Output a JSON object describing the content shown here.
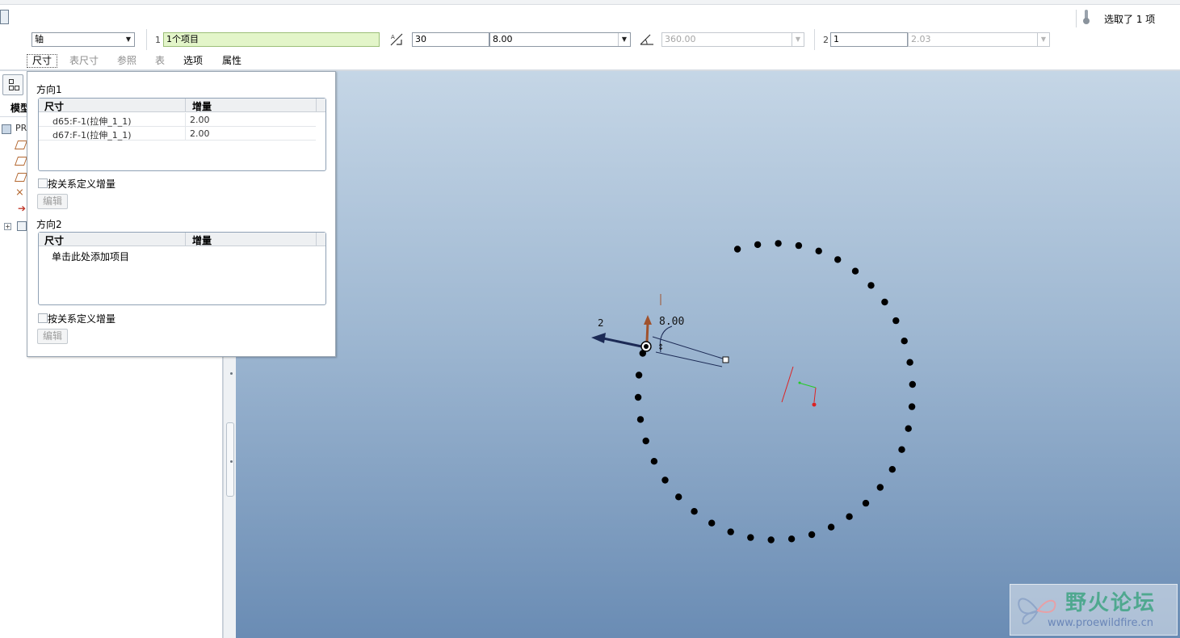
{
  "dashboard": {
    "status_text": "选取了 1 项",
    "type_select": "轴",
    "dir1_index": "1",
    "dir1_collector": "1个项目",
    "count_value": "30",
    "increment_value": "8.00",
    "angle_value": "360.00",
    "dir2_index": "2",
    "dir2_count": "1",
    "dir2_increment": "2.03",
    "tabs": [
      {
        "label": "尺寸"
      },
      {
        "label": "表尺寸"
      },
      {
        "label": "参照"
      },
      {
        "label": "表"
      },
      {
        "label": "选项"
      },
      {
        "label": "属性"
      }
    ]
  },
  "model_tree": {
    "tab_label": "模型",
    "root_label": "PR"
  },
  "popup": {
    "direction1_label": "方向1",
    "direction2_label": "方向2",
    "col_dimension": "尺寸",
    "col_increment": "增量",
    "dir1_rows": [
      {
        "dimension": "d65:F-1(拉伸_1_1)",
        "increment": "2.00"
      },
      {
        "dimension": "d67:F-1(拉伸_1_1)",
        "increment": "2.00"
      }
    ],
    "dir2_placeholder": "单击此处添加项目",
    "relation_checkbox_label": "按关系定义增量",
    "edit_button_label": "编辑"
  },
  "graphics": {
    "dim_label_angle": "8.00",
    "dir2_label": "2",
    "pattern_points": 36
  },
  "watermark": {
    "title": "野火论坛",
    "url": "www.proewildfire.cn"
  },
  "colors": {
    "graphics_top": "#c5d6e6",
    "graphics_bottom": "#6a8cb4",
    "collector_green": "#e3f5c9",
    "arrow_navy": "#1c2a55",
    "arrow_brown": "#a0522d"
  }
}
